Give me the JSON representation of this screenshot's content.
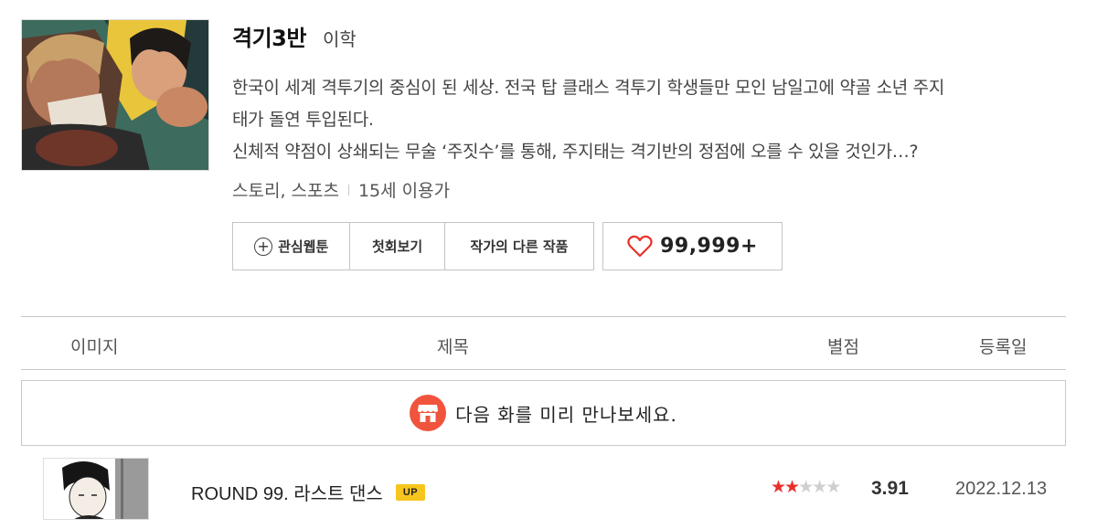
{
  "webtoon": {
    "title": "격기3반",
    "author": "이학",
    "description_lines": [
      "한국이 세계 격투기의 중심이 된 세상. 전국 탑 클래스 격투기 학생들만 모인 남일고에 약골 소년 주지",
      "태가 돌연 투입된다.",
      "신체적 약점이 상쇄되는 무술 ‘주짓수’를 통해, 주지태는 격기반의 정점에 오를 수 있을 것인가…?"
    ],
    "genre": "스토리, 스포츠",
    "age_rating": "15세 이용가",
    "thumbnail_icon": "webtoon-cover-art"
  },
  "buttons": {
    "favorite": "관심웹툰",
    "first_episode": "첫회보기",
    "other_works": "작가의 다른 작품",
    "like_count": "99,999+"
  },
  "table": {
    "headers": {
      "image": "이미지",
      "title": "제목",
      "rating": "별점",
      "date": "등록일"
    }
  },
  "preview_banner": {
    "text": "다음 화를 미리 만나보세요.",
    "icon": "store-icon"
  },
  "episodes": [
    {
      "title": "ROUND 99. 라스트 댄스",
      "badge": "UP",
      "stars_filled": 2,
      "stars_total": 5,
      "rating": "3.91",
      "date": "2022.12.13"
    }
  ],
  "colors": {
    "heart": "#e8302a",
    "star": "#e8302a",
    "badge": "#f7c51e",
    "store_icon": "#f0543c"
  }
}
